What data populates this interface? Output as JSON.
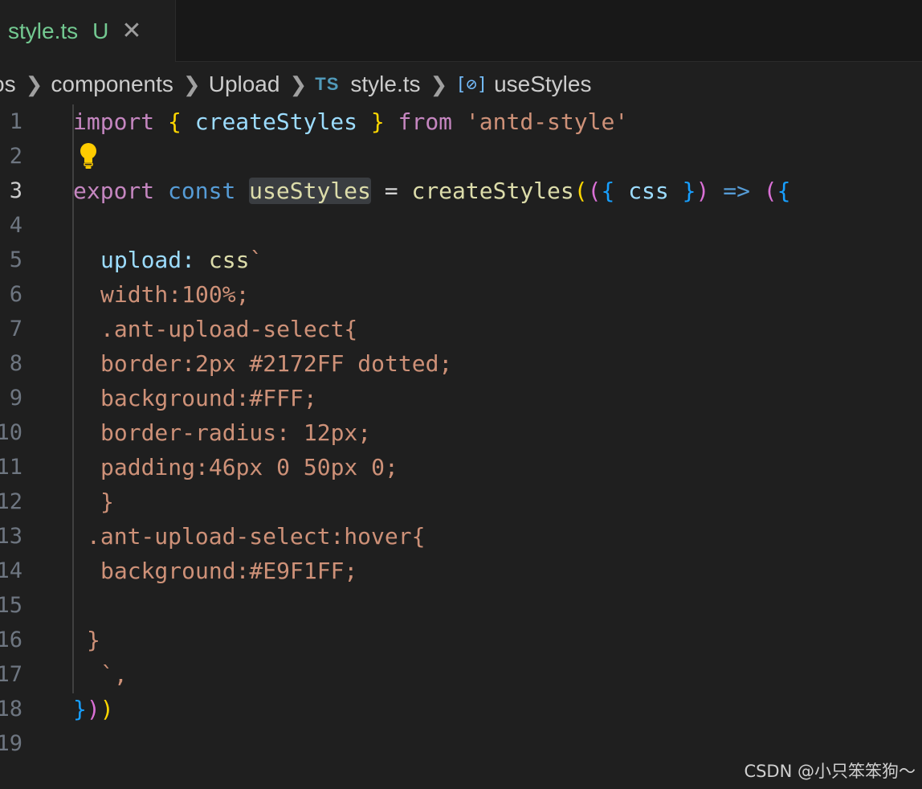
{
  "tab": {
    "name": "style.ts",
    "status": "U",
    "close": "✕"
  },
  "breadcrumb": {
    "items": [
      "os",
      "components",
      "Upload",
      "style.ts",
      "useStyles"
    ],
    "ts_icon": "TS",
    "symbol_icon": "[⊘]"
  },
  "editor": {
    "active_line": 3,
    "line_numbers": [
      "1",
      "2",
      "3",
      "4",
      "5",
      "6",
      "7",
      "8",
      "9",
      "10",
      "11",
      "12",
      "13",
      "14",
      "15",
      "16",
      "17",
      "18",
      "19"
    ],
    "line1": {
      "import": "import",
      "ob": "{",
      "name": "createStyles",
      "cb": "}",
      "from": "from",
      "module": "'antd-style'"
    },
    "line3": {
      "export": "export",
      "const": "const",
      "name": "useStyles",
      "eq": "=",
      "fn": "createStyles",
      "p1": "(",
      "p2": "(",
      "ob": "{",
      "arg": "css",
      "cb": "}",
      "p3": ")",
      "arrow": "=>",
      "p4": "(",
      "ob2": "{"
    },
    "line5": {
      "key": "upload:",
      "tag": "css",
      "tick": "`"
    },
    "line6": "width:100%;",
    "line7": ".ant-upload-select{",
    "line8": "border:2px #2172FF dotted;",
    "line9": "background:#FFF;",
    "line10": "border-radius: 12px;",
    "line11": "padding:46px 0 50px 0;",
    "line12": "}",
    "line13": ".ant-upload-select:hover{",
    "line14": "background:#E9F1FF;",
    "line16": "}",
    "line17": "`,",
    "line18": {
      "cb": "}",
      "p1": ")",
      "p2": ")"
    }
  },
  "watermark": "CSDN @小只笨笨狗～",
  "colors": {
    "keyword": "#c586c0",
    "storage": "#569cd6",
    "string": "#ce9178",
    "function": "#dcdcaa",
    "variable": "#9cdcfe",
    "modified": "#73c991"
  }
}
